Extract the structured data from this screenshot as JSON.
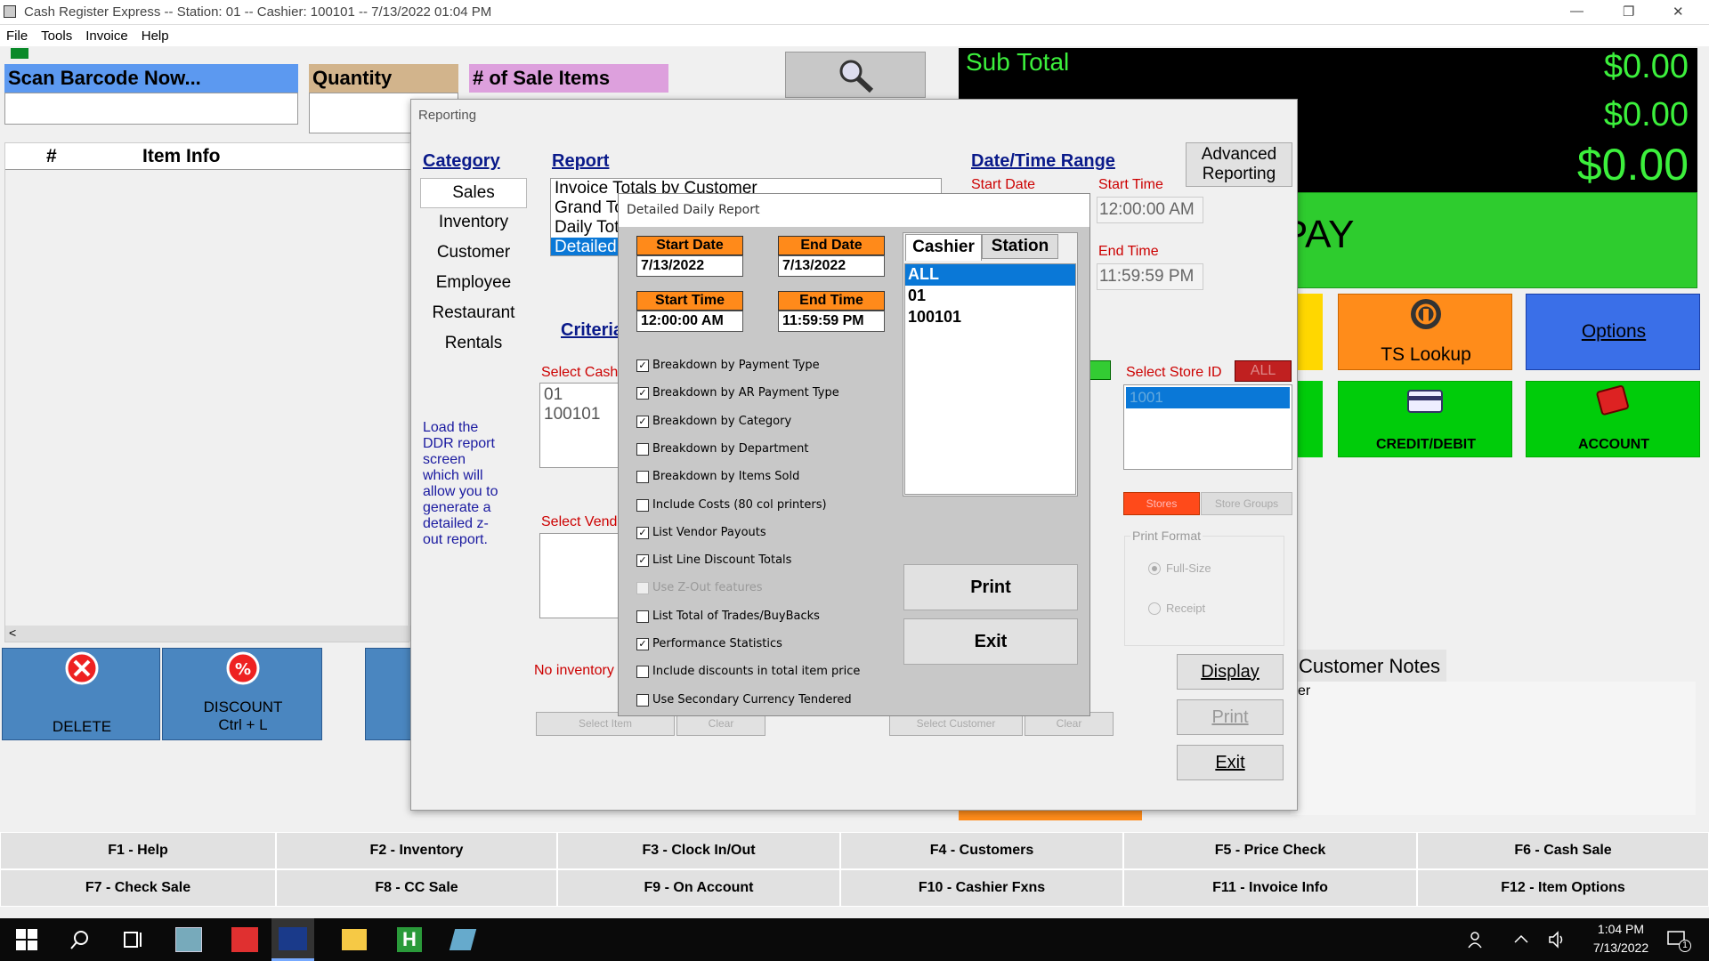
{
  "window": {
    "title": "Cash Register Express -- Station: 01 -- Cashier: 100101 -- 7/13/2022 01:04 PM",
    "minimize": "—",
    "maximize": "❐",
    "close": "✕"
  },
  "menu": [
    "File",
    "Tools",
    "Invoice",
    "Help"
  ],
  "top": {
    "scan_label": "Scan Barcode Now...",
    "quantity_label": "Quantity",
    "sale_items_label": "# of Sale Items"
  },
  "grid": {
    "col_num": "#",
    "col_info": "Item Info",
    "scroll_left": "<"
  },
  "totals": {
    "subtotal_label": "Sub Total",
    "subtotal": "$0.00",
    "tax": "$0.00",
    "total": "$0.00",
    "pay_label": "PAY"
  },
  "tiles": {
    "ts_lookup": "TS Lookup",
    "options": "Options",
    "credit_debit": "CREDIT/DEBIT",
    "account": "ACCOUNT"
  },
  "left_buttons": {
    "delete": "DELETE",
    "discount": "DISCOUNT",
    "discount_shortcut": "Ctrl + L"
  },
  "customer_notes": {
    "label": "Customer Notes",
    "snippet": "er"
  },
  "fkeys": [
    [
      "F1 - Help",
      "F2 - Inventory",
      "F3 - Clock In/Out",
      "F4 - Customers",
      "F5 - Price Check",
      "F6 - Cash Sale"
    ],
    [
      "F7 - Check Sale",
      "F8 - CC Sale",
      "F9 - On Account",
      "F10 - Cashier Fxns",
      "F11 - Invoice Info",
      "F12 - Item Options"
    ]
  ],
  "reporting": {
    "title": "Reporting",
    "category_head": "Category",
    "categories": [
      "Sales",
      "Inventory",
      "Customer",
      "Employee",
      "Restaurant",
      "Rentals"
    ],
    "report_head": "Report",
    "reports": [
      "Invoice Totals by Customer",
      "Grand To",
      "Daily Tot",
      "Detailed"
    ],
    "criteria_head": "Criteria",
    "description": "Load the DDR report screen which will allow you to generate a detailed z-out report.",
    "select_cashier": "Select Cash",
    "cashiers": [
      "01",
      "100101"
    ],
    "select_vendor": "Select Vend",
    "no_inventory": "No inventory",
    "select_item": "Select Item",
    "clear": "Clear",
    "select_customer": "Select Customer",
    "date_range_head": "Date/Time Range",
    "start_date": "Start Date",
    "start_time": "Start Time",
    "start_time_value": "12:00:00 AM",
    "end_time": "End Time",
    "end_time_value": "11:59:59 PM",
    "advanced": "Advanced Reporting",
    "all_badge_left": "",
    "select_store": "Select Store ID",
    "all": "ALL",
    "store_id": "1001",
    "stores": "Stores",
    "store_groups": "Store Groups",
    "print_format": "Print Format",
    "full_size": "Full-Size",
    "receipt": "Receipt",
    "display": "Display",
    "print": "Print",
    "exit": "Exit"
  },
  "ddr": {
    "title": "Detailed Daily Report",
    "start_date_label": "Start Date",
    "start_date": "7/13/2022",
    "end_date_label": "End Date",
    "end_date": "7/13/2022",
    "start_time_label": "Start Time",
    "start_time": "12:00:00 AM",
    "end_time_label": "End Time",
    "end_time": "11:59:59 PM",
    "options": [
      {
        "label": "Breakdown by Payment Type",
        "checked": true,
        "enabled": true
      },
      {
        "label": "Breakdown by AR Payment Type",
        "checked": true,
        "enabled": true
      },
      {
        "label": "Breakdown by Category",
        "checked": true,
        "enabled": true
      },
      {
        "label": "Breakdown by Department",
        "checked": false,
        "enabled": true
      },
      {
        "label": "Breakdown by Items Sold",
        "checked": false,
        "enabled": true
      },
      {
        "label": "Include Costs (80 col printers)",
        "checked": false,
        "enabled": true
      },
      {
        "label": "List Vendor Payouts",
        "checked": true,
        "enabled": true
      },
      {
        "label": "List Line Discount Totals",
        "checked": true,
        "enabled": true
      },
      {
        "label": "Use Z-Out features",
        "checked": false,
        "enabled": false
      },
      {
        "label": "List Total of Trades/BuyBacks",
        "checked": false,
        "enabled": true
      },
      {
        "label": "Performance Statistics",
        "checked": true,
        "enabled": true
      },
      {
        "label": "Include discounts in total item price",
        "checked": false,
        "enabled": true
      },
      {
        "label": "Use Secondary Currency Tendered",
        "checked": false,
        "enabled": true
      }
    ],
    "tab_cashier": "Cashier",
    "tab_station": "Station",
    "list": [
      "ALL",
      "01",
      "100101"
    ],
    "print": "Print",
    "exit": "Exit"
  },
  "taskbar": {
    "time": "1:04 PM",
    "date": "7/13/2022",
    "notification_count": "1"
  }
}
